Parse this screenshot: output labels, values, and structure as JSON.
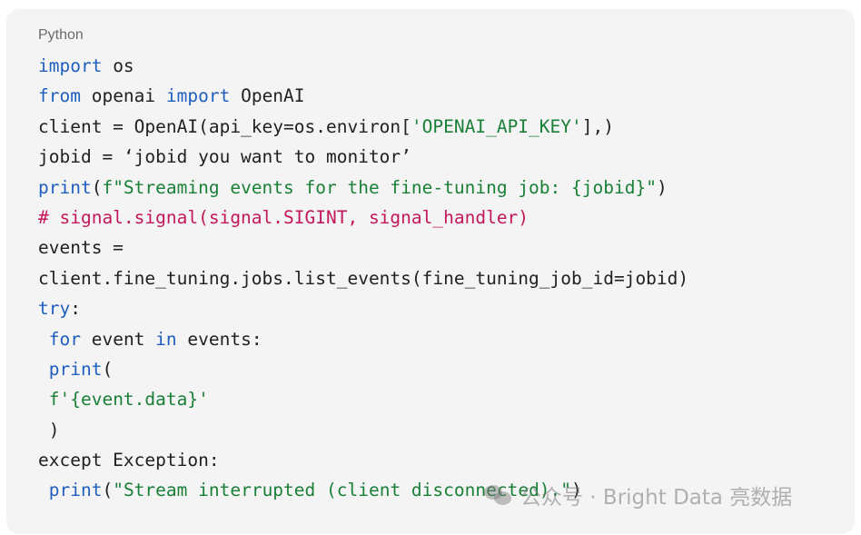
{
  "code_block": {
    "language": "Python",
    "lines": [
      [
        {
          "t": "import",
          "c": "kw"
        },
        {
          "t": " os",
          "c": "pl"
        }
      ],
      [
        {
          "t": "from",
          "c": "kw"
        },
        {
          "t": " openai ",
          "c": "pl"
        },
        {
          "t": "import",
          "c": "kw"
        },
        {
          "t": " OpenAI",
          "c": "pl"
        }
      ],
      [
        {
          "t": "client = OpenAI(api_key=os.environ[",
          "c": "pl"
        },
        {
          "t": "'OPENAI_API_KEY'",
          "c": "str"
        },
        {
          "t": "],)",
          "c": "pl"
        }
      ],
      [
        {
          "t": "jobid = ‘jobid you want to monitor’",
          "c": "pl"
        }
      ],
      [
        {
          "t": "print",
          "c": "fn"
        },
        {
          "t": "(",
          "c": "pl"
        },
        {
          "t": "f\"Streaming events for the fine-tuning job: {jobid}\"",
          "c": "str"
        },
        {
          "t": ")",
          "c": "pl"
        }
      ],
      [
        {
          "t": "# signal.signal(signal.SIGINT, signal_handler)",
          "c": "cm"
        }
      ],
      [
        {
          "t": "events =",
          "c": "pl"
        }
      ],
      [
        {
          "t": "client.fine_tuning.jobs.list_events(fine_tuning_job_id=jobid)",
          "c": "pl"
        }
      ],
      [
        {
          "t": "try",
          "c": "kw"
        },
        {
          "t": ":",
          "c": "pl"
        }
      ],
      [
        {
          "t": " ",
          "c": "pl"
        },
        {
          "t": "for",
          "c": "kw"
        },
        {
          "t": " event ",
          "c": "pl"
        },
        {
          "t": "in",
          "c": "kw"
        },
        {
          "t": " events:",
          "c": "pl"
        }
      ],
      [
        {
          "t": " ",
          "c": "pl"
        },
        {
          "t": "print",
          "c": "fn"
        },
        {
          "t": "(",
          "c": "pl"
        }
      ],
      [
        {
          "t": " ",
          "c": "pl"
        },
        {
          "t": "f'{event.data}'",
          "c": "str"
        }
      ],
      [
        {
          "t": " )",
          "c": "pl"
        }
      ],
      [
        {
          "t": "except Exception:",
          "c": "pl"
        }
      ],
      [
        {
          "t": " ",
          "c": "pl"
        },
        {
          "t": "print",
          "c": "fn"
        },
        {
          "t": "(",
          "c": "pl"
        },
        {
          "t": "\"Stream interrupted (client disconnected).\"",
          "c": "str"
        },
        {
          "t": ")",
          "c": "pl"
        }
      ]
    ]
  },
  "watermark": {
    "icon": "wechat-icon",
    "text": "公众号 · Bright Data 亮数据"
  },
  "colors": {
    "keyword": "#1f5fbf",
    "string": "#1a7f37",
    "comment": "#c2185b",
    "plain": "#202124",
    "background": "#f4f4f4"
  }
}
